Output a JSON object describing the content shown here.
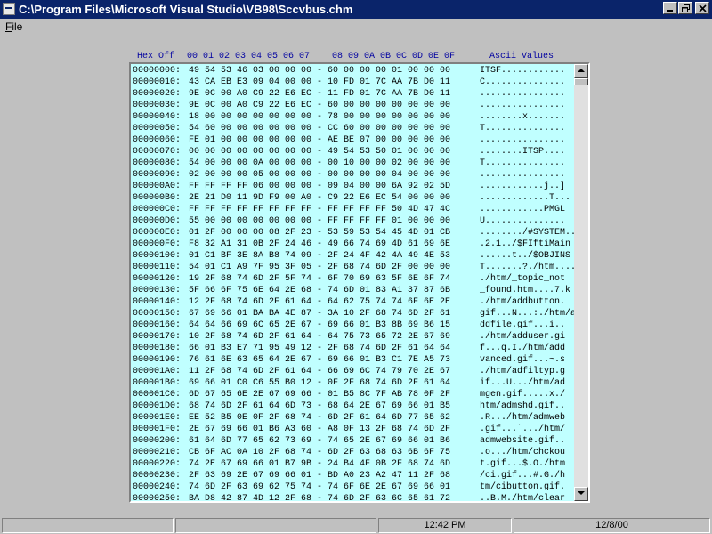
{
  "window": {
    "title": "C:\\Program Files\\Microsoft Visual Studio\\VB98\\Sccvbus.chm"
  },
  "menu": {
    "file_accel": "F",
    "file_rest": "ile"
  },
  "header": {
    "offset": "Hex Off",
    "cols_a": "00 01 02 03 04 05 06 07",
    "cols_b": "08 09 0A 0B 0C 0D 0E 0F",
    "ascii": "Ascii Values"
  },
  "rows": [
    {
      "off": "00000000:",
      "hex": "49 54 53 46 03 00 00 00 - 60 00 00 00 01 00 00 00",
      "asc": "ITSF............"
    },
    {
      "off": "00000010:",
      "hex": "43 CA EB E3 09 04 00 00 - 10 FD 01 7C AA 7B D0 11",
      "asc": "C..............."
    },
    {
      "off": "00000020:",
      "hex": "9E 0C 00 A0 C9 22 E6 EC - 11 FD 01 7C AA 7B D0 11",
      "asc": "................"
    },
    {
      "off": "00000030:",
      "hex": "9E 0C 00 A0 C9 22 E6 EC - 60 00 00 00 00 00 00 00",
      "asc": "................"
    },
    {
      "off": "00000040:",
      "hex": "18 00 00 00 00 00 00 00 - 78 00 00 00 00 00 00 00",
      "asc": "........x......."
    },
    {
      "off": "00000050:",
      "hex": "54 60 00 00 00 00 00 00 - CC 60 00 00 00 00 00 00",
      "asc": "T..............."
    },
    {
      "off": "00000060:",
      "hex": "FE 01 00 00 00 00 00 00 - AE BE 07 00 00 00 00 00",
      "asc": "................"
    },
    {
      "off": "00000070:",
      "hex": "00 00 00 00 00 00 00 00 - 49 54 53 50 01 00 00 00",
      "asc": "........ITSP...."
    },
    {
      "off": "00000080:",
      "hex": "54 00 00 00 0A 00 00 00 - 00 10 00 00 02 00 00 00",
      "asc": "T..............."
    },
    {
      "off": "00000090:",
      "hex": "02 00 00 00 05 00 00 00 - 00 00 00 00 04 00 00 00",
      "asc": "................"
    },
    {
      "off": "000000A0:",
      "hex": "FF FF FF FF 06 00 00 00 - 09 04 00 00 6A 92 02 5D",
      "asc": "............j..]"
    },
    {
      "off": "000000B0:",
      "hex": "2E 21 D0 11 9D F9 00 A0 - C9 22 E6 EC 54 00 00 00",
      "asc": ".............T..."
    },
    {
      "off": "000000C0:",
      "hex": "FF FF FF FF FF FF FF FF - FF FF FF FF 50 4D 47 4C",
      "asc": "............PMGL"
    },
    {
      "off": "000000D0:",
      "hex": "55 00 00 00 00 00 00 00 - FF FF FF FF 01 00 00 00",
      "asc": "U..............."
    },
    {
      "off": "000000E0:",
      "hex": "01 2F 00 00 00 08 2F 23 - 53 59 53 54 45 4D 01 CB",
      "asc": "......../#SYSTEM.."
    },
    {
      "off": "000000F0:",
      "hex": "F8 32 A1 31 0B 2F 24 46 - 49 66 74 69 4D 61 69 6E",
      "asc": ".2.1../$FIftiMain"
    },
    {
      "off": "00000100:",
      "hex": "01 C1 BF 3E 8A B8 74 09 - 2F 24 4F 42 4A 49 4E 53",
      "asc": "......t../$OBJINS"
    },
    {
      "off": "00000110:",
      "hex": "54 01 C1 A9 7F 95 3F 05 - 2F 68 74 6D 2F 00 00 00",
      "asc": "T.......?./htm...."
    },
    {
      "off": "00000120:",
      "hex": "19 2F 68 74 6D 2F 5F 74 - 6F 70 69 63 5F 6E 6F 74",
      "asc": "./htm/_topic_not"
    },
    {
      "off": "00000130:",
      "hex": "5F 66 6F 75 6E 64 2E 68 - 74 6D 01 83 A1 37 87 6B",
      "asc": "_found.htm....7.k"
    },
    {
      "off": "00000140:",
      "hex": "12 2F 68 74 6D 2F 61 64 - 64 62 75 74 74 6F 6E 2E",
      "asc": "./htm/addbutton."
    },
    {
      "off": "00000150:",
      "hex": "67 69 66 01 BA BA 4E 87 - 3A 10 2F 68 74 6D 2F 61",
      "asc": "gif...N...:./htm/a"
    },
    {
      "off": "00000160:",
      "hex": "64 64 66 69 6C 65 2E 67 - 69 66 01 B3 8B 69 B6 15",
      "asc": "ddfile.gif...i.."
    },
    {
      "off": "00000170:",
      "hex": "10 2F 68 74 6D 2F 61 64 - 64 75 73 65 72 2E 67 69",
      "asc": "./htm/adduser.gi"
    },
    {
      "off": "00000180:",
      "hex": "66 01 B3 E7 71 95 49 12 - 2F 68 74 6D 2F 61 64 64",
      "asc": "f...q.I./htm/add"
    },
    {
      "off": "00000190:",
      "hex": "76 61 6E 63 65 64 2E 67 - 69 66 01 B3 C1 7E A5 73",
      "asc": "vanced.gif...~.s"
    },
    {
      "off": "000001A0:",
      "hex": "11 2F 68 74 6D 2F 61 64 - 66 69 6C 74 79 70 2E 67",
      "asc": "./htm/adfiltyp.g"
    },
    {
      "off": "000001B0:",
      "hex": "69 66 01 C0 C6 55 B0 12 - 0F 2F 68 74 6D 2F 61 64",
      "asc": "if...U.../htm/ad"
    },
    {
      "off": "000001C0:",
      "hex": "6D 67 65 6E 2E 67 69 66 - 01 B5 8C 7F AB 78 0F 2F",
      "asc": "mgen.gif.....x./"
    },
    {
      "off": "000001D0:",
      "hex": "68 74 6D 2F 61 64 6D 73 - 68 64 2E 67 69 66 01 B5",
      "asc": "htm/admshd.gif.."
    },
    {
      "off": "000001E0:",
      "hex": "EE 52 B5 0E 0F 2F 68 74 - 6D 2F 61 64 6D 77 65 62",
      "asc": ".R.../htm/admweb"
    },
    {
      "off": "000001F0:",
      "hex": "2E 67 69 66 01 B6 A3 60 - A8 0F 13 2F 68 74 6D 2F",
      "asc": ".gif...`.../htm/"
    },
    {
      "off": "00000200:",
      "hex": "61 64 6D 77 65 62 73 69 - 74 65 2E 67 69 66 01 B6",
      "asc": "admwebsite.gif.."
    },
    {
      "off": "00000210:",
      "hex": "CB 6F AC 0A 10 2F 68 74 - 6D 2F 63 68 63 6B 6F 75",
      "asc": ".o.../htm/chckou"
    },
    {
      "off": "00000220:",
      "hex": "74 2E 67 69 66 01 B7 9B - 24 B4 4F 0B 2F 68 74 6D",
      "asc": "t.gif...$.O./htm"
    },
    {
      "off": "00000230:",
      "hex": "2F 63 69 2E 67 69 66 01 - BD A0 23 A2 47 11 2F 68",
      "asc": "/ci.gif...#.G./h"
    },
    {
      "off": "00000240:",
      "hex": "74 6D 2F 63 69 62 75 74 - 74 6F 6E 2E 67 69 66 01",
      "asc": "tm/cibutton.gif."
    },
    {
      "off": "00000250:",
      "hex": "BA D8 42 87 4D 12 2F 68 - 74 6D 2F 63 6C 65 61 72",
      "asc": "..B.M./htm/clear"
    },
    {
      "off": "00000260:",
      "hex": "62 6F 6F 6B 2E 67 69 66 - 01 BE C5 1C 87 55 0B 2F",
      "asc": "book.gif.....U./"
    }
  ],
  "status": {
    "time": "12:42 PM",
    "date": "12/8/00"
  }
}
